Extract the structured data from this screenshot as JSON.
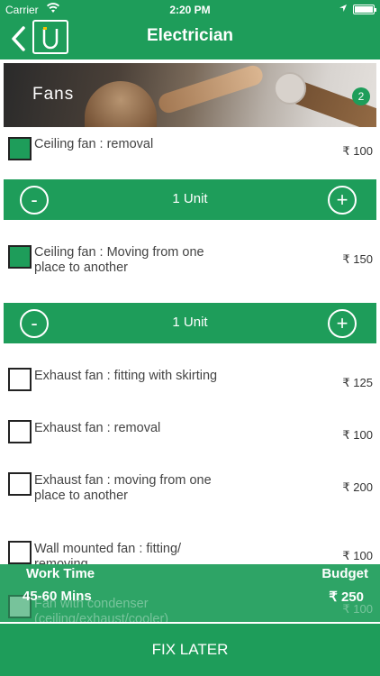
{
  "status_bar": {
    "carrier": "Carrier",
    "time": "2:20 PM"
  },
  "nav": {
    "title": "Electrician"
  },
  "banner": {
    "title": "Fans",
    "badge": "2"
  },
  "items": [
    {
      "label": "Ceiling fan : removal",
      "price": "₹ 100",
      "checked": true,
      "quantity": "1 Unit"
    },
    {
      "label": "Ceiling fan : Moving from one place to another",
      "price": "₹ 150",
      "checked": true,
      "quantity": "1 Unit"
    },
    {
      "label": "Exhaust fan : fitting with skirting",
      "price": "₹ 125",
      "checked": false
    },
    {
      "label": "Exhaust fan : removal",
      "price": "₹ 100",
      "checked": false
    },
    {
      "label": "Exhaust fan : moving from one place to another",
      "price": "₹ 200",
      "checked": false
    },
    {
      "label": "Wall mounted fan : fitting/ removing",
      "price": "₹ 100",
      "checked": false
    },
    {
      "label": "Fan with condenser (ceiling/exhaust/cooler)",
      "price": "₹ 100",
      "checked": false
    }
  ],
  "stepper": {
    "minus": "-",
    "plus": "+"
  },
  "summary": {
    "work_time_label": "Work Time",
    "work_time_value": "45-60 Mins",
    "budget_label": "Budget",
    "budget_value": "₹ 250"
  },
  "footer": {
    "fix_later": "FIX LATER"
  },
  "colors": {
    "brand": "#1e9d5a"
  }
}
